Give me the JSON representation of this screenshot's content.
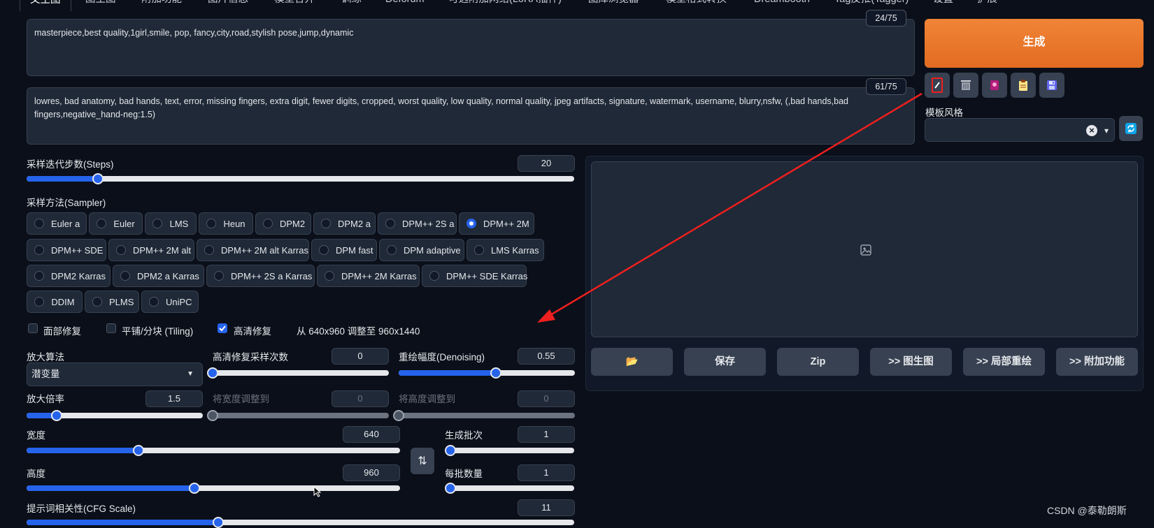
{
  "tabs": [
    "文生图",
    "图生图",
    "附加功能",
    "图片信息",
    "模型合并",
    "训练",
    "Deforum",
    "可选附加网络(LoRA插件)",
    "图库浏览器",
    "模型格式转换",
    "Dreambooth",
    "Tag反推(Tagger)",
    "设置",
    "扩展"
  ],
  "prompt": {
    "positive": "masterpiece,best quality,1girl,smile, pop, fancy,city,road,stylish pose,jump,dynamic",
    "positive_counter": "24/75",
    "negative": "lowres, bad anatomy, bad hands, text, error, missing fingers, extra digit, fewer digits, cropped, worst quality, low quality, normal quality, jpeg artifacts, signature, watermark, username, blurry,nsfw, (,bad hands,bad fingers,negative_hand-neg:1.5)",
    "negative_counter": "61/75"
  },
  "generate": {
    "label": "生成"
  },
  "tools": [
    "pencil-icon",
    "trash-icon",
    "pink-card-icon",
    "clipboard-icon",
    "save-icon"
  ],
  "style": {
    "label": "模板风格",
    "clear": "×",
    "arrow": "▾"
  },
  "steps": {
    "label": "采样迭代步数(Steps)",
    "value": "20",
    "fraction": 0.13
  },
  "sampler": {
    "label": "采样方法(Sampler)",
    "selected": "DPM++ 2M",
    "rows": [
      [
        "Euler a",
        "Euler",
        "LMS",
        "Heun",
        "DPM2",
        "DPM2 a",
        "DPM++ 2S a",
        "DPM++ 2M"
      ],
      [
        "DPM++ SDE",
        "DPM++ 2M alt",
        "DPM++ 2M alt Karras",
        "DPM fast",
        "DPM adaptive",
        "LMS Karras"
      ],
      [
        "DPM2 Karras",
        "DPM2 a Karras",
        "DPM++ 2S a Karras",
        "DPM++ 2M Karras",
        "DPM++ SDE Karras"
      ],
      [
        "DDIM",
        "PLMS",
        "UniPC"
      ]
    ]
  },
  "checks": {
    "face": {
      "label": "面部修复",
      "checked": false
    },
    "tiling": {
      "label": "平铺/分块 (Tiling)",
      "checked": false
    },
    "hires": {
      "label": "高清修复",
      "checked": true
    }
  },
  "resize_info": "从 640x960 调整至 960x1440",
  "hires": {
    "upscaler_label": "放大算法",
    "upscaler_value": "潜变量",
    "steps_label": "高清修复采样次数",
    "steps_value": "0",
    "steps_fraction": 0.0,
    "denoise_label": "重绘幅度(Denoising)",
    "denoise_value": "0.55",
    "denoise_fraction": 0.55,
    "scale_label": "放大倍率",
    "scale_value": "1.5",
    "scale_fraction": 0.17,
    "resize_w_label": "将宽度调整到",
    "resize_w_value": "0",
    "resize_h_label": "将高度调整到",
    "resize_h_value": "0"
  },
  "size": {
    "width_label": "宽度",
    "width_value": "640",
    "width_fraction": 0.3,
    "height_label": "高度",
    "height_value": "960",
    "height_fraction": 0.45,
    "swap": "⇅"
  },
  "batch": {
    "count_label": "生成批次",
    "count_value": "1",
    "size_label": "每批数量",
    "size_value": "1"
  },
  "cfg": {
    "label": "提示词相关性(CFG Scale)",
    "value": "11",
    "fraction": 0.35
  },
  "actions": [
    "📂",
    "保存",
    "Zip",
    ">> 图生图",
    ">> 局部重绘",
    ">> 附加功能"
  ],
  "watermark": "CSDN @泰勒朗斯",
  "colors": {
    "accent": "#2563eb",
    "generate": "#ea7a2e",
    "annotation": "#ef1f1f"
  }
}
